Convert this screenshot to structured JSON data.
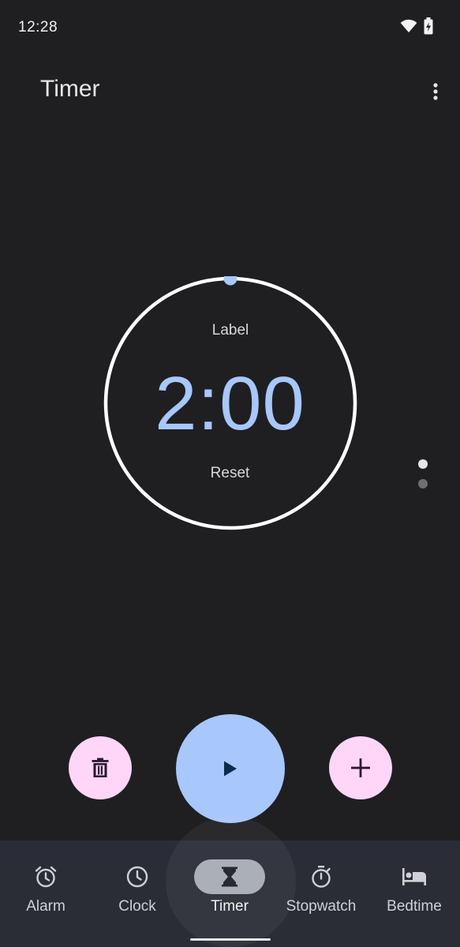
{
  "status_bar": {
    "time": "12:28",
    "icons": [
      "wifi-icon",
      "battery-charging-icon"
    ]
  },
  "app_bar": {
    "title": "Timer",
    "menu_icon": "more-vert-icon"
  },
  "timer": {
    "label": "Label",
    "time": "2:00",
    "reset": "Reset",
    "progress": 0.0
  },
  "page_indicator": {
    "pages": 2,
    "active": 0
  },
  "actions": {
    "delete_icon": "trash-icon",
    "play_icon": "play-icon",
    "add_icon": "plus-icon"
  },
  "bottom_nav": {
    "active": "Timer",
    "items": [
      {
        "label": "Alarm",
        "icon": "alarm-icon"
      },
      {
        "label": "Clock",
        "icon": "clock-icon"
      },
      {
        "label": "Timer",
        "icon": "hourglass-icon"
      },
      {
        "label": "Stopwatch",
        "icon": "stopwatch-icon"
      },
      {
        "label": "Bedtime",
        "icon": "bed-icon"
      }
    ]
  },
  "colors": {
    "background": "#1f1f22",
    "accent": "#a8c7fa",
    "fab_secondary": "#ffd6f8",
    "nav_background": "#2a2d36",
    "nav_active_pill": "#a7abb5"
  }
}
